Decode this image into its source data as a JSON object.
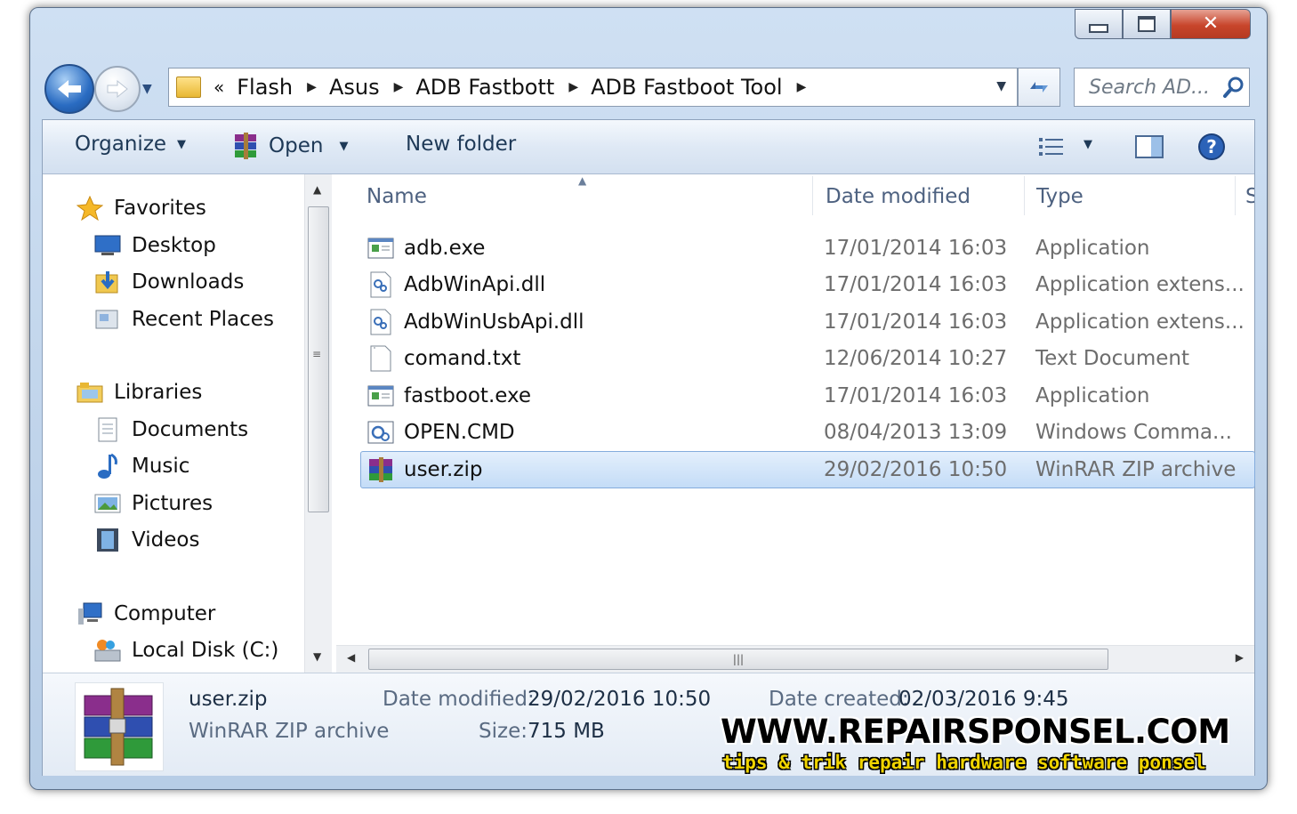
{
  "window": {
    "controls": {
      "minimize": "minimize",
      "maximize": "maximize",
      "close": "close"
    }
  },
  "address_bar": {
    "overflow": "«",
    "crumbs": [
      "Flash",
      "Asus",
      "ADB Fastbott",
      "ADB Fastboot Tool"
    ]
  },
  "search": {
    "placeholder": "Search AD..."
  },
  "toolbar": {
    "organize_label": "Organize",
    "open_label": "Open",
    "new_folder_label": "New folder"
  },
  "nav_pane": {
    "favorites": {
      "label": "Favorites",
      "items": [
        "Desktop",
        "Downloads",
        "Recent Places"
      ]
    },
    "libraries": {
      "label": "Libraries",
      "items": [
        "Documents",
        "Music",
        "Pictures",
        "Videos"
      ]
    },
    "computer": {
      "label": "Computer",
      "items": [
        "Local Disk (C:)"
      ]
    }
  },
  "columns": {
    "name": "Name",
    "date": "Date modified",
    "type": "Type",
    "size": "S"
  },
  "files": [
    {
      "name": "adb.exe",
      "date": "17/01/2014 16:03",
      "type": "Application",
      "icon": "exe-icon"
    },
    {
      "name": "AdbWinApi.dll",
      "date": "17/01/2014 16:03",
      "type": "Application extens...",
      "icon": "dll-icon"
    },
    {
      "name": "AdbWinUsbApi.dll",
      "date": "17/01/2014 16:03",
      "type": "Application extens...",
      "icon": "dll-icon"
    },
    {
      "name": "comand.txt",
      "date": "12/06/2014 10:27",
      "type": "Text Document",
      "icon": "txt-icon"
    },
    {
      "name": "fastboot.exe",
      "date": "17/01/2014 16:03",
      "type": "Application",
      "icon": "exe-icon"
    },
    {
      "name": "OPEN.CMD",
      "date": "08/04/2013 13:09",
      "type": "Windows Comma...",
      "icon": "cmd-icon"
    },
    {
      "name": "user.zip",
      "date": "29/02/2016 10:50",
      "type": "WinRAR ZIP archive",
      "icon": "winrar-icon",
      "selected": true
    }
  ],
  "details": {
    "name": "user.zip",
    "type": "WinRAR ZIP archive",
    "date_modified_label": "Date modified:",
    "date_modified": "29/02/2016 10:50",
    "size_label": "Size:",
    "size": "715 MB",
    "date_created_label": "Date created:",
    "date_created": "02/03/2016 9:45"
  },
  "watermark": {
    "site": "WWW.REPAIRSPONSEL.COM",
    "tagline": "tips & trik repair hardware software ponsel"
  },
  "colors": {
    "selection": "#c4dcf7",
    "frame": "#bfd3ea",
    "watermark_yellow": "#f0d400"
  }
}
